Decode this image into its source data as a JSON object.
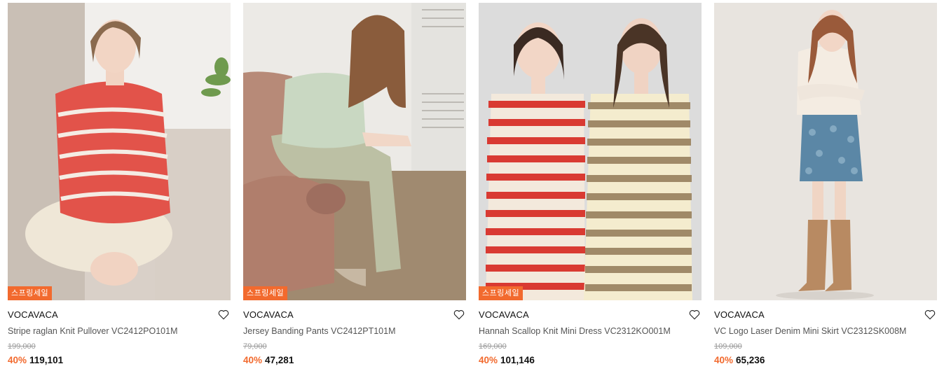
{
  "colors": {
    "accent": "#f26a2e",
    "original_price": "#9a9a9a"
  },
  "products": [
    {
      "badge": "스프링세일",
      "brand": "VOCAVACA",
      "name": "Stripe raglan Knit Pullover VC2412PO101M",
      "original_price": "199,000",
      "discount": "40%",
      "price": "119,101",
      "wishlist_icon": "heart-outline-icon"
    },
    {
      "badge": "스프링세일",
      "brand": "VOCAVACA",
      "name": "Jersey Banding Pants VC2412PT101M",
      "original_price": "79,000",
      "discount": "40%",
      "price": "47,281",
      "wishlist_icon": "heart-outline-icon"
    },
    {
      "badge": "스프링세일",
      "brand": "VOCAVACA",
      "name": "Hannah Scallop Knit Mini Dress VC2312KO001M",
      "original_price": "169,000",
      "discount": "40%",
      "price": "101,146",
      "wishlist_icon": "heart-outline-icon"
    },
    {
      "brand": "VOCAVACA",
      "name": "VC Logo Laser Denim Mini Skirt VC2312SK008M",
      "original_price": "109,000",
      "discount": "40%",
      "price": "65,236",
      "wishlist_icon": "heart-outline-icon"
    }
  ]
}
